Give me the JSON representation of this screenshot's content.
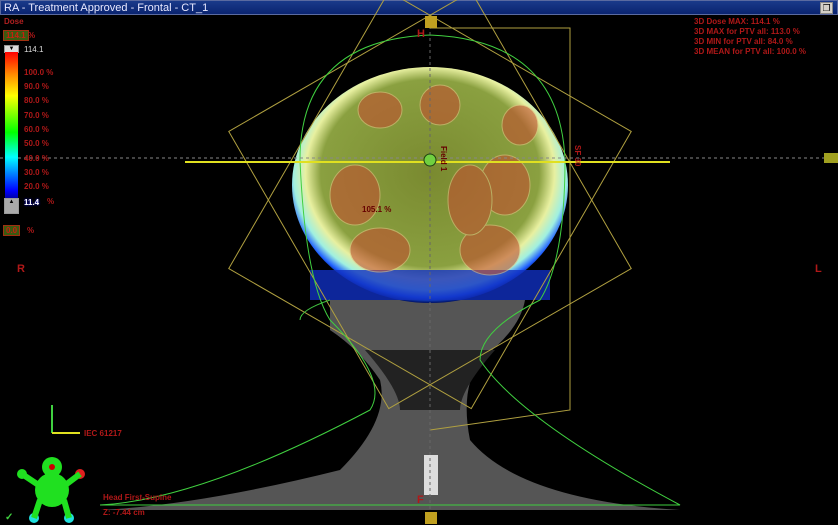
{
  "window": {
    "title": "RA - Treatment Approved - Frontal - CT_1",
    "restore_icon": "restore-icon"
  },
  "dose_legend": {
    "title": "Dose",
    "max_box": "114.1",
    "max_unit": "%",
    "max_value": "114.1",
    "levels": [
      "100.0 %",
      "90.0 %",
      "80.0 %",
      "70.0 %",
      "60.0 %",
      "50.0 %",
      "40.0 %",
      "30.0 %",
      "20.0 %"
    ],
    "min_value": "11.4",
    "min_unit": "%",
    "low_box": "0.0",
    "low_unit": "%"
  },
  "stats": [
    "3D Dose MAX: 114.1 %",
    "3D MAX for PTV all: 113.0 %",
    "3D MIN for PTV all: 84.0 %",
    "3D MEAN for PTV all: 100.0 %"
  ],
  "orientation": {
    "head": "H",
    "foot": "F",
    "right": "R",
    "left": "L"
  },
  "annotations": {
    "hotspot": "105.1 %",
    "field": "Field 1",
    "beam": "SF 30"
  },
  "coord_system": "IEC 61217",
  "patient": {
    "position": "Head First-Supine",
    "z": "Z: -7.44 cm"
  },
  "status_check": "✓"
}
